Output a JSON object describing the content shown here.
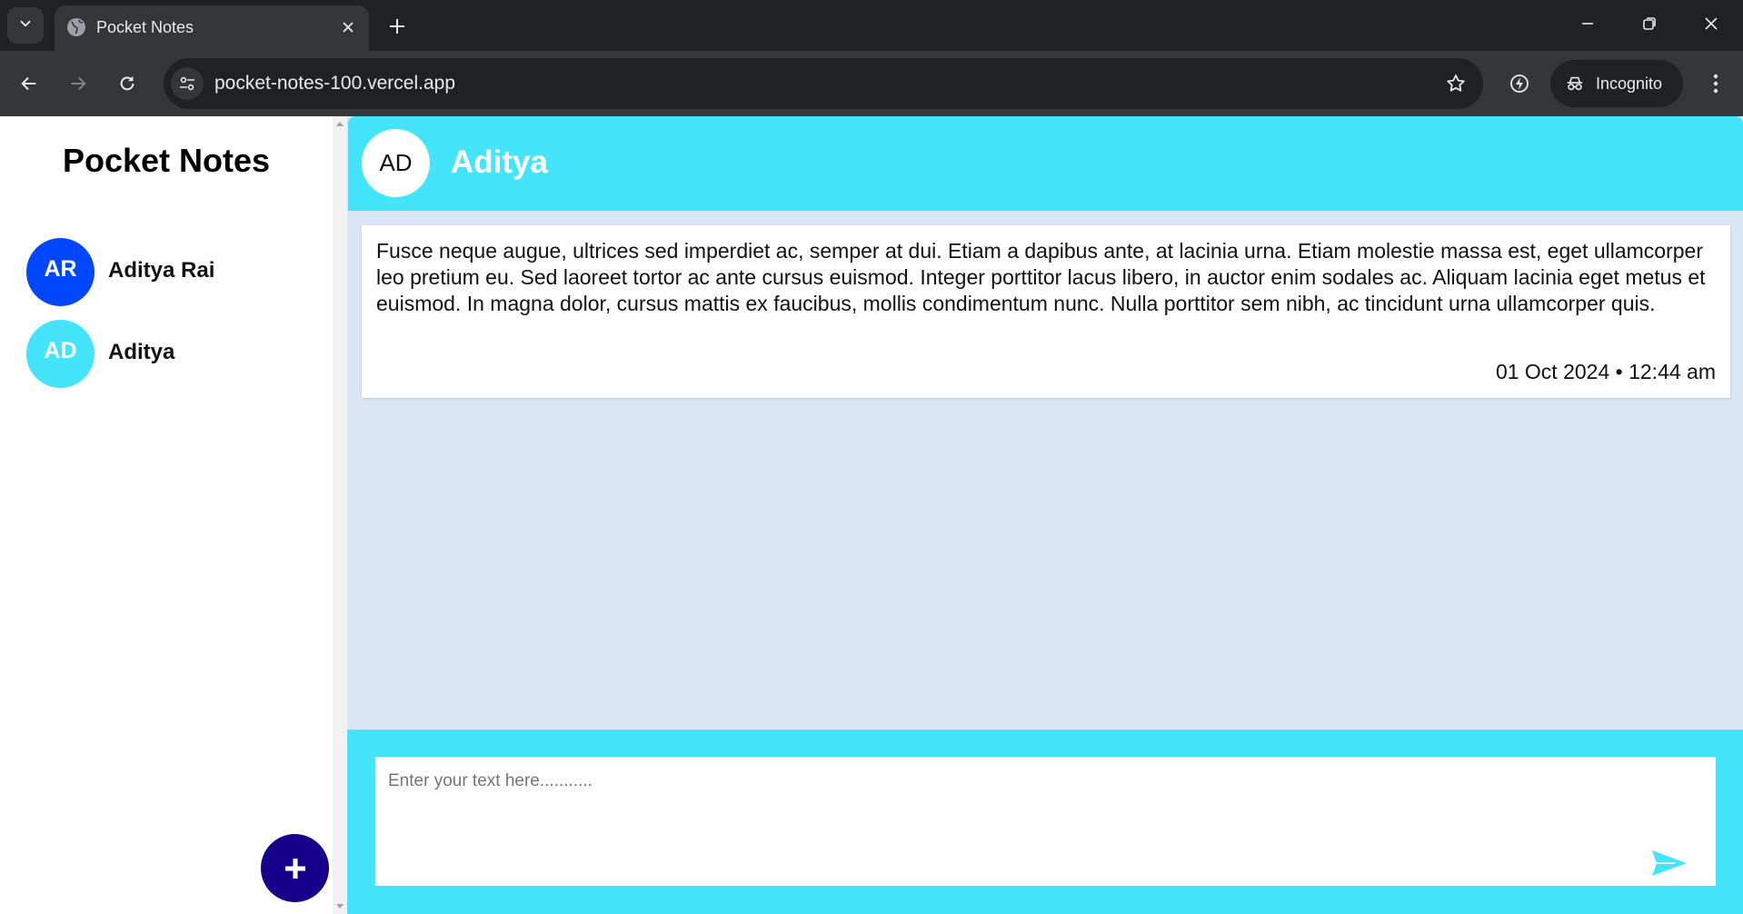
{
  "browser": {
    "tab_title": "Pocket Notes",
    "url": "pocket-notes-100.vercel.app",
    "incognito_label": "Incognito",
    "icons": {
      "tab_search": "chevron-down-icon",
      "favicon": "globe-icon",
      "tab_close": "close-icon",
      "new_tab": "plus-icon",
      "back": "arrow-left-icon",
      "forward": "arrow-right-icon",
      "reload": "reload-icon",
      "site_info": "tune-icon",
      "bookmark": "star-icon",
      "extension": "lightning-icon",
      "incognito": "incognito-icon",
      "menu": "more-vert-icon",
      "minimize": "minimize-icon",
      "restore": "restore-icon",
      "close_window": "close-icon"
    }
  },
  "sidebar": {
    "title": "Pocket Notes",
    "groups": [
      {
        "initials": "AR",
        "name": "Aditya Rai",
        "color": "#0047ff"
      },
      {
        "initials": "AD",
        "name": "Aditya",
        "color": "#44e5fa"
      }
    ],
    "add_button_icon": "plus-icon",
    "add_button_color": "#16008b"
  },
  "chat": {
    "initials": "AD",
    "title": "Aditya",
    "header_color": "#44e5fa",
    "background_color": "#dae5f5",
    "notes": [
      {
        "text": "Fusce neque augue, ultrices sed imperdiet ac, semper at dui. Etiam a dapibus ante, at lacinia urna. Etiam molestie massa est, eget ullamcorper leo pretium eu. Sed laoreet tortor ac ante cursus euismod. Integer porttitor lacus libero, in auctor enim sodales ac. Aliquam lacinia eget metus et euismod. In magna dolor, cursus mattis ex faucibus, mollis condimentum nunc. Nulla porttitor sem nibh, ac tincidunt urna ullamcorper quis.",
        "date": "01 Oct 2024",
        "separator": "•",
        "time": "12:44 am"
      }
    ],
    "composer": {
      "placeholder": "Enter your text here...........",
      "value": "",
      "send_icon": "send-icon"
    }
  }
}
